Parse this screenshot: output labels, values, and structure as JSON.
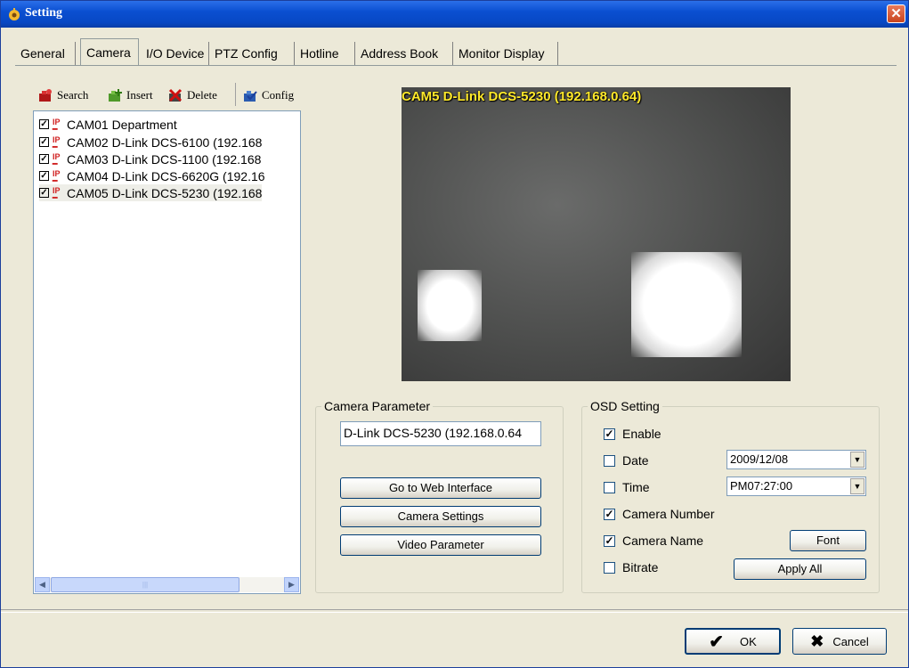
{
  "window": {
    "title": "Setting"
  },
  "tabs": [
    "General",
    "Camera",
    "I/O Device",
    "PTZ Config",
    "Hotline",
    "Address Book",
    "Monitor Display"
  ],
  "toolbar": {
    "search": "Search",
    "insert": "Insert",
    "delete": "Delete",
    "config": "Config"
  },
  "cameras": [
    {
      "label": "CAM01 Department",
      "checked": true
    },
    {
      "label": "CAM02 D-Link DCS-6100 (192.168",
      "checked": true
    },
    {
      "label": "CAM03 D-Link DCS-1100 (192.168",
      "checked": true
    },
    {
      "label": "CAM04 D-Link DCS-6620G (192.16",
      "checked": true
    },
    {
      "label": "CAM05 D-Link DCS-5230 (192.168",
      "checked": true,
      "selected": true
    }
  ],
  "preview": {
    "overlay": "CAM5 D-Link DCS-5230 (192.168.0.64)"
  },
  "camera_parameter": {
    "legend": "Camera Parameter",
    "name_value": "D-Link DCS-5230 (192.168.0.64",
    "web_button": "Go to Web Interface",
    "settings_button": "Camera Settings",
    "video_button": "Video Parameter"
  },
  "osd": {
    "legend": "OSD Setting",
    "enable": {
      "label": "Enable",
      "checked": true
    },
    "date": {
      "label": "Date",
      "checked": false,
      "value": "2009/12/08"
    },
    "time": {
      "label": "Time",
      "checked": false,
      "value": "PM07:27:00"
    },
    "camera_number": {
      "label": "Camera Number",
      "checked": true
    },
    "camera_name": {
      "label": "Camera Name",
      "checked": true
    },
    "bitrate": {
      "label": "Bitrate",
      "checked": false
    },
    "font_button": "Font",
    "apply_all_button": "Apply All"
  },
  "dialog": {
    "ok": "OK",
    "cancel": "Cancel"
  },
  "colors": {
    "titlebar": "#0a4fd1",
    "overlay_text": "#ffe92a",
    "close": "#c9441d"
  }
}
